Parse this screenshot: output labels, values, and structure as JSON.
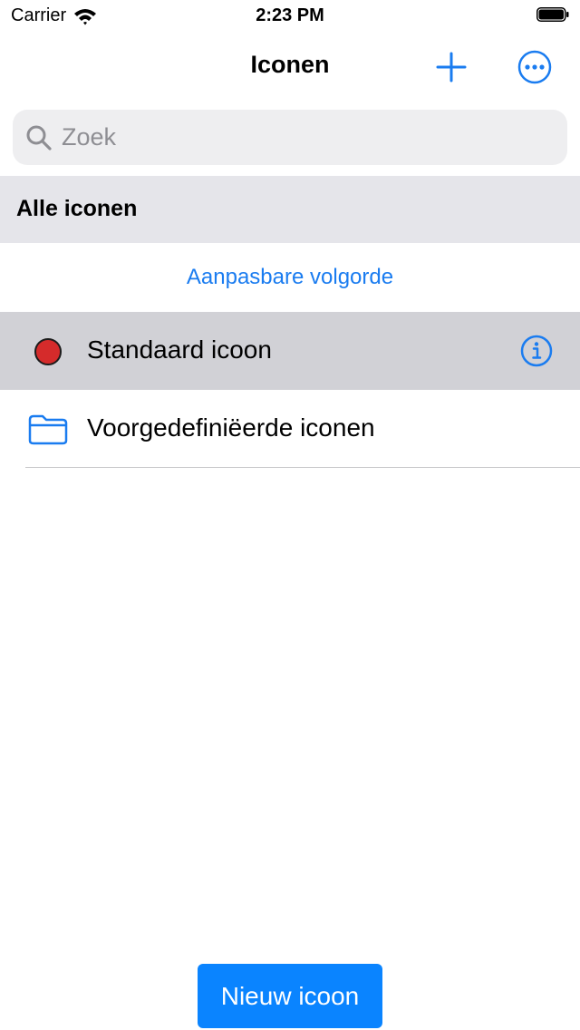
{
  "status_bar": {
    "carrier": "Carrier",
    "time": "2:23 PM"
  },
  "nav": {
    "title": "Iconen",
    "add_icon": "plus-icon",
    "more_icon": "ellipsis-circle-icon"
  },
  "search": {
    "placeholder": "Zoek",
    "value": ""
  },
  "section": {
    "header": "Alle iconen"
  },
  "sort_link": "Aanpasbare volgorde",
  "rows": [
    {
      "label": "Standaard icoon",
      "icon": "red-circle-icon",
      "selected": true,
      "accessory": "info-icon"
    },
    {
      "label": "Voorgedefiniëerde iconen",
      "icon": "folder-icon",
      "selected": false
    }
  ],
  "new_button": "Nieuw icoon",
  "colors": {
    "accent": "#1a7cf0",
    "button": "#0a84ff",
    "red_dot": "#d52b2b",
    "selected_row": "#d1d1d6",
    "section_bg": "#e5e5ea"
  }
}
